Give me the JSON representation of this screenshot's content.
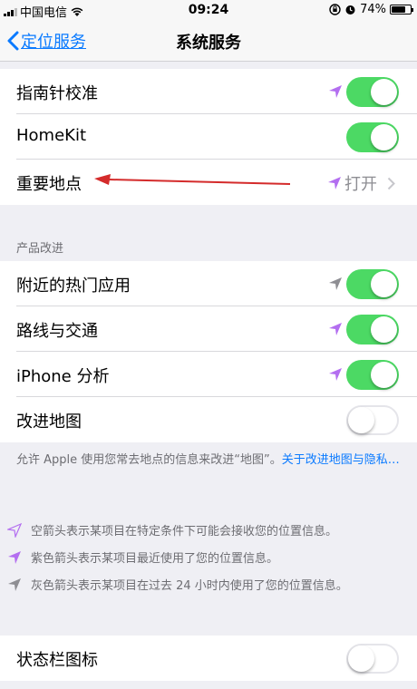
{
  "status_bar": {
    "carrier": "中国电信",
    "time": "09:24",
    "battery": "74%",
    "battery_level": 0.74
  },
  "nav": {
    "back_label": "定位服务",
    "title": "系统服务"
  },
  "group1": {
    "compass_calibration": "指南针校准",
    "homekit": "HomeKit",
    "significant_locations": "重要地点",
    "significant_locations_value": "打开"
  },
  "group2": {
    "header": "产品改进",
    "popular_near_me": "附近的热门应用",
    "routing_traffic": "路线与交通",
    "iphone_analytics": "iPhone 分析",
    "improve_maps": "改进地图",
    "footer_text": "允许 Apple 使用您常去地点的信息来改进“地图”。",
    "footer_link": "关于改进地图与隐私…"
  },
  "legend": {
    "hollow": "空箭头表示某项目在特定条件下可能会接收您的位置信息。",
    "purple": "紫色箭头表示某项目最近使用了您的位置信息。",
    "gray": "灰色箭头表示某项目在过去 24 小时内使用了您的位置信息。"
  },
  "group3": {
    "status_bar_icon": "状态栏图标"
  },
  "toggles": {
    "compass_calibration": true,
    "homekit": true,
    "popular_near_me": true,
    "routing_traffic": true,
    "iphone_analytics": true,
    "improve_maps": false,
    "status_bar_icon": false
  },
  "icons": {
    "location_arrow_purple": "location-arrow-purple-icon",
    "location_arrow_gray": "location-arrow-gray-icon",
    "location_arrow_hollow": "location-arrow-hollow-icon"
  },
  "colors": {
    "accent": "#0a7aff",
    "toggle_on": "#4cd964",
    "arrow_purple": "#b36ef0",
    "arrow_gray": "#8e8e93",
    "annotation_arrow": "#d42b2b"
  }
}
